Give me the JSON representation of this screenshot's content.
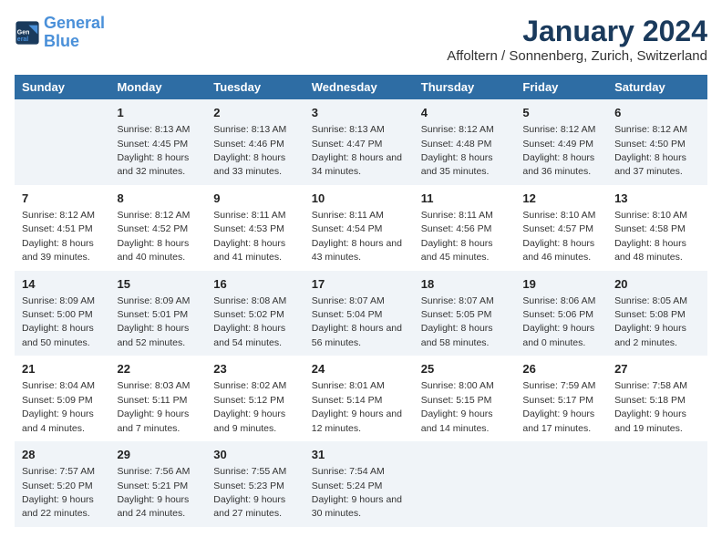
{
  "logo": {
    "line1": "General",
    "line2": "Blue"
  },
  "title": "January 2024",
  "subtitle": "Affoltern / Sonnenberg, Zurich, Switzerland",
  "days_of_week": [
    "Sunday",
    "Monday",
    "Tuesday",
    "Wednesday",
    "Thursday",
    "Friday",
    "Saturday"
  ],
  "weeks": [
    [
      {
        "num": "",
        "sunrise": "",
        "sunset": "",
        "daylight": ""
      },
      {
        "num": "1",
        "sunrise": "Sunrise: 8:13 AM",
        "sunset": "Sunset: 4:45 PM",
        "daylight": "Daylight: 8 hours and 32 minutes."
      },
      {
        "num": "2",
        "sunrise": "Sunrise: 8:13 AM",
        "sunset": "Sunset: 4:46 PM",
        "daylight": "Daylight: 8 hours and 33 minutes."
      },
      {
        "num": "3",
        "sunrise": "Sunrise: 8:13 AM",
        "sunset": "Sunset: 4:47 PM",
        "daylight": "Daylight: 8 hours and 34 minutes."
      },
      {
        "num": "4",
        "sunrise": "Sunrise: 8:12 AM",
        "sunset": "Sunset: 4:48 PM",
        "daylight": "Daylight: 8 hours and 35 minutes."
      },
      {
        "num": "5",
        "sunrise": "Sunrise: 8:12 AM",
        "sunset": "Sunset: 4:49 PM",
        "daylight": "Daylight: 8 hours and 36 minutes."
      },
      {
        "num": "6",
        "sunrise": "Sunrise: 8:12 AM",
        "sunset": "Sunset: 4:50 PM",
        "daylight": "Daylight: 8 hours and 37 minutes."
      }
    ],
    [
      {
        "num": "7",
        "sunrise": "Sunrise: 8:12 AM",
        "sunset": "Sunset: 4:51 PM",
        "daylight": "Daylight: 8 hours and 39 minutes."
      },
      {
        "num": "8",
        "sunrise": "Sunrise: 8:12 AM",
        "sunset": "Sunset: 4:52 PM",
        "daylight": "Daylight: 8 hours and 40 minutes."
      },
      {
        "num": "9",
        "sunrise": "Sunrise: 8:11 AM",
        "sunset": "Sunset: 4:53 PM",
        "daylight": "Daylight: 8 hours and 41 minutes."
      },
      {
        "num": "10",
        "sunrise": "Sunrise: 8:11 AM",
        "sunset": "Sunset: 4:54 PM",
        "daylight": "Daylight: 8 hours and 43 minutes."
      },
      {
        "num": "11",
        "sunrise": "Sunrise: 8:11 AM",
        "sunset": "Sunset: 4:56 PM",
        "daylight": "Daylight: 8 hours and 45 minutes."
      },
      {
        "num": "12",
        "sunrise": "Sunrise: 8:10 AM",
        "sunset": "Sunset: 4:57 PM",
        "daylight": "Daylight: 8 hours and 46 minutes."
      },
      {
        "num": "13",
        "sunrise": "Sunrise: 8:10 AM",
        "sunset": "Sunset: 4:58 PM",
        "daylight": "Daylight: 8 hours and 48 minutes."
      }
    ],
    [
      {
        "num": "14",
        "sunrise": "Sunrise: 8:09 AM",
        "sunset": "Sunset: 5:00 PM",
        "daylight": "Daylight: 8 hours and 50 minutes."
      },
      {
        "num": "15",
        "sunrise": "Sunrise: 8:09 AM",
        "sunset": "Sunset: 5:01 PM",
        "daylight": "Daylight: 8 hours and 52 minutes."
      },
      {
        "num": "16",
        "sunrise": "Sunrise: 8:08 AM",
        "sunset": "Sunset: 5:02 PM",
        "daylight": "Daylight: 8 hours and 54 minutes."
      },
      {
        "num": "17",
        "sunrise": "Sunrise: 8:07 AM",
        "sunset": "Sunset: 5:04 PM",
        "daylight": "Daylight: 8 hours and 56 minutes."
      },
      {
        "num": "18",
        "sunrise": "Sunrise: 8:07 AM",
        "sunset": "Sunset: 5:05 PM",
        "daylight": "Daylight: 8 hours and 58 minutes."
      },
      {
        "num": "19",
        "sunrise": "Sunrise: 8:06 AM",
        "sunset": "Sunset: 5:06 PM",
        "daylight": "Daylight: 9 hours and 0 minutes."
      },
      {
        "num": "20",
        "sunrise": "Sunrise: 8:05 AM",
        "sunset": "Sunset: 5:08 PM",
        "daylight": "Daylight: 9 hours and 2 minutes."
      }
    ],
    [
      {
        "num": "21",
        "sunrise": "Sunrise: 8:04 AM",
        "sunset": "Sunset: 5:09 PM",
        "daylight": "Daylight: 9 hours and 4 minutes."
      },
      {
        "num": "22",
        "sunrise": "Sunrise: 8:03 AM",
        "sunset": "Sunset: 5:11 PM",
        "daylight": "Daylight: 9 hours and 7 minutes."
      },
      {
        "num": "23",
        "sunrise": "Sunrise: 8:02 AM",
        "sunset": "Sunset: 5:12 PM",
        "daylight": "Daylight: 9 hours and 9 minutes."
      },
      {
        "num": "24",
        "sunrise": "Sunrise: 8:01 AM",
        "sunset": "Sunset: 5:14 PM",
        "daylight": "Daylight: 9 hours and 12 minutes."
      },
      {
        "num": "25",
        "sunrise": "Sunrise: 8:00 AM",
        "sunset": "Sunset: 5:15 PM",
        "daylight": "Daylight: 9 hours and 14 minutes."
      },
      {
        "num": "26",
        "sunrise": "Sunrise: 7:59 AM",
        "sunset": "Sunset: 5:17 PM",
        "daylight": "Daylight: 9 hours and 17 minutes."
      },
      {
        "num": "27",
        "sunrise": "Sunrise: 7:58 AM",
        "sunset": "Sunset: 5:18 PM",
        "daylight": "Daylight: 9 hours and 19 minutes."
      }
    ],
    [
      {
        "num": "28",
        "sunrise": "Sunrise: 7:57 AM",
        "sunset": "Sunset: 5:20 PM",
        "daylight": "Daylight: 9 hours and 22 minutes."
      },
      {
        "num": "29",
        "sunrise": "Sunrise: 7:56 AM",
        "sunset": "Sunset: 5:21 PM",
        "daylight": "Daylight: 9 hours and 24 minutes."
      },
      {
        "num": "30",
        "sunrise": "Sunrise: 7:55 AM",
        "sunset": "Sunset: 5:23 PM",
        "daylight": "Daylight: 9 hours and 27 minutes."
      },
      {
        "num": "31",
        "sunrise": "Sunrise: 7:54 AM",
        "sunset": "Sunset: 5:24 PM",
        "daylight": "Daylight: 9 hours and 30 minutes."
      },
      {
        "num": "",
        "sunrise": "",
        "sunset": "",
        "daylight": ""
      },
      {
        "num": "",
        "sunrise": "",
        "sunset": "",
        "daylight": ""
      },
      {
        "num": "",
        "sunrise": "",
        "sunset": "",
        "daylight": ""
      }
    ]
  ]
}
